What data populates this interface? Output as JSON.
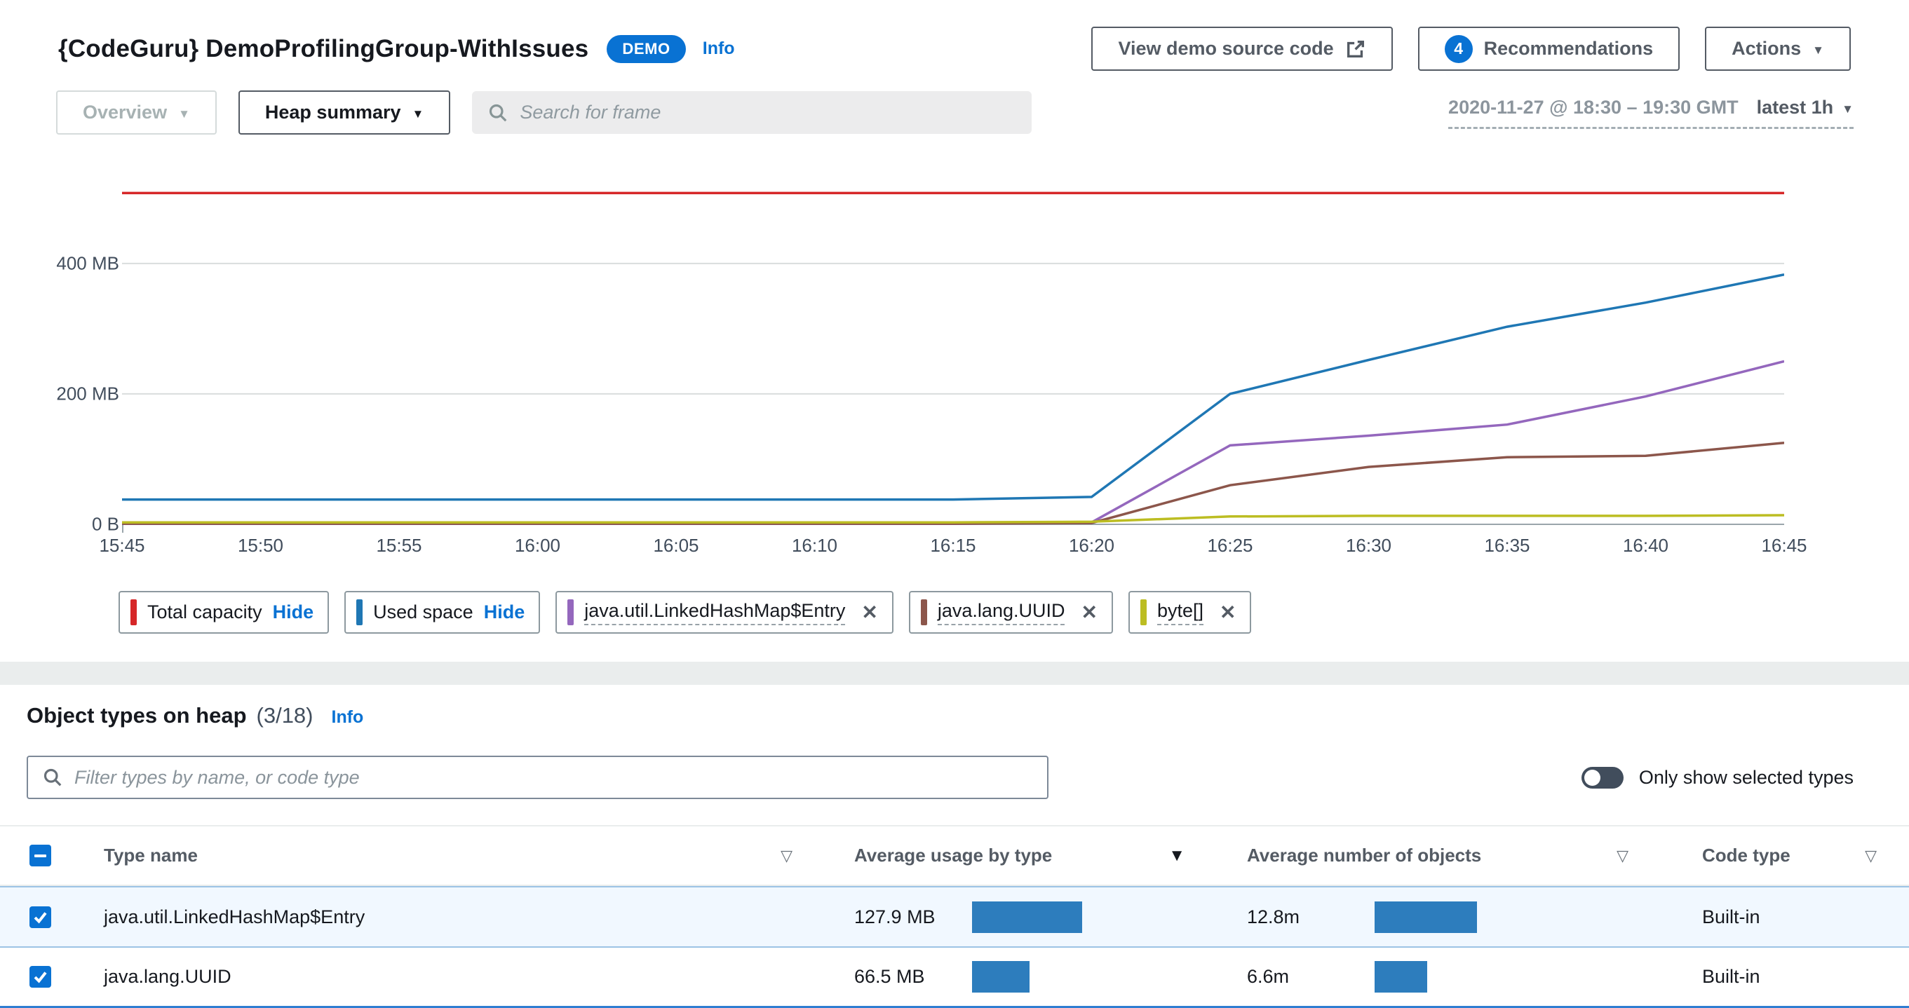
{
  "header": {
    "title": "{CodeGuru} DemoProfilingGroup-WithIssues",
    "demo_badge": "DEMO",
    "info_label": "Info",
    "view_source_button": "View demo source code",
    "recommendations_count": "4",
    "recommendations_button": "Recommendations",
    "actions_button": "Actions"
  },
  "toolbar": {
    "overview_dropdown": "Overview",
    "view_dropdown": "Heap summary",
    "search_placeholder": "Search for frame",
    "time_range": "2020-11-27 @ 18:30 – 19:30 GMT",
    "time_preset": "latest 1h"
  },
  "chart_data": {
    "type": "line",
    "x": [
      "15:45",
      "15:50",
      "15:55",
      "16:00",
      "16:05",
      "16:10",
      "16:15",
      "16:20",
      "16:25",
      "16:30",
      "16:35",
      "16:40",
      "16:45"
    ],
    "y_ticks": [
      "400 MB",
      "200 MB",
      "0 B"
    ],
    "ylabel": "",
    "xlabel": "",
    "unit": "MB",
    "ylim": [
      0,
      560
    ],
    "grid": true,
    "legend_position": "bottom",
    "series": [
      {
        "name": "Total capacity",
        "color": "#d62728",
        "values": [
          508,
          508,
          508,
          508,
          508,
          508,
          508,
          508,
          508,
          508,
          508,
          508,
          508
        ]
      },
      {
        "name": "Used space",
        "color": "#1f77b4",
        "values": [
          38,
          38,
          38,
          38,
          38,
          38,
          38,
          42,
          200,
          252,
          303,
          340,
          383
        ]
      },
      {
        "name": "java.util.LinkedHashMap$Entry",
        "color": "#9467bd",
        "values": [
          1,
          1,
          1,
          1,
          1,
          1,
          1,
          3,
          121,
          136,
          153,
          196,
          250
        ]
      },
      {
        "name": "java.lang.UUID",
        "color": "#8c564b",
        "values": [
          1,
          1,
          1,
          1,
          1,
          1,
          1,
          2,
          60,
          88,
          103,
          105,
          125
        ]
      },
      {
        "name": "byte[]",
        "color": "#bcbd22",
        "values": [
          3,
          3,
          3,
          3,
          3,
          3,
          3,
          4,
          12,
          13,
          13,
          13,
          14
        ]
      }
    ]
  },
  "legend": {
    "items": [
      {
        "label": "Total capacity",
        "color": "#d62728",
        "action": "Hide"
      },
      {
        "label": "Used space",
        "color": "#1f77b4",
        "action": "Hide"
      },
      {
        "label": "java.util.LinkedHashMap$Entry",
        "color": "#9467bd",
        "action": "remove"
      },
      {
        "label": "java.lang.UUID",
        "color": "#8c564b",
        "action": "remove"
      },
      {
        "label": "byte[]",
        "color": "#bcbd22",
        "action": "remove"
      }
    ]
  },
  "object_types": {
    "title": "Object types on heap",
    "count": "(3/18)",
    "info_label": "Info",
    "filter_placeholder": "Filter types by name, or code type",
    "toggle_label": "Only show selected types"
  },
  "table": {
    "columns": [
      "Type name",
      "Average usage by type",
      "Average number of objects",
      "Code type"
    ],
    "rows": [
      {
        "type_name": "java.util.LinkedHashMap$Entry",
        "usage": "127.9 MB",
        "usage_mb": 127.9,
        "objects": "12.8m",
        "objects_m": 12.8,
        "code_type": "Built-in",
        "selected": true
      },
      {
        "type_name": "java.lang.UUID",
        "usage": "66.5 MB",
        "usage_mb": 66.5,
        "objects": "6.6m",
        "objects_m": 6.6,
        "code_type": "Built-in",
        "selected": true
      }
    ]
  }
}
